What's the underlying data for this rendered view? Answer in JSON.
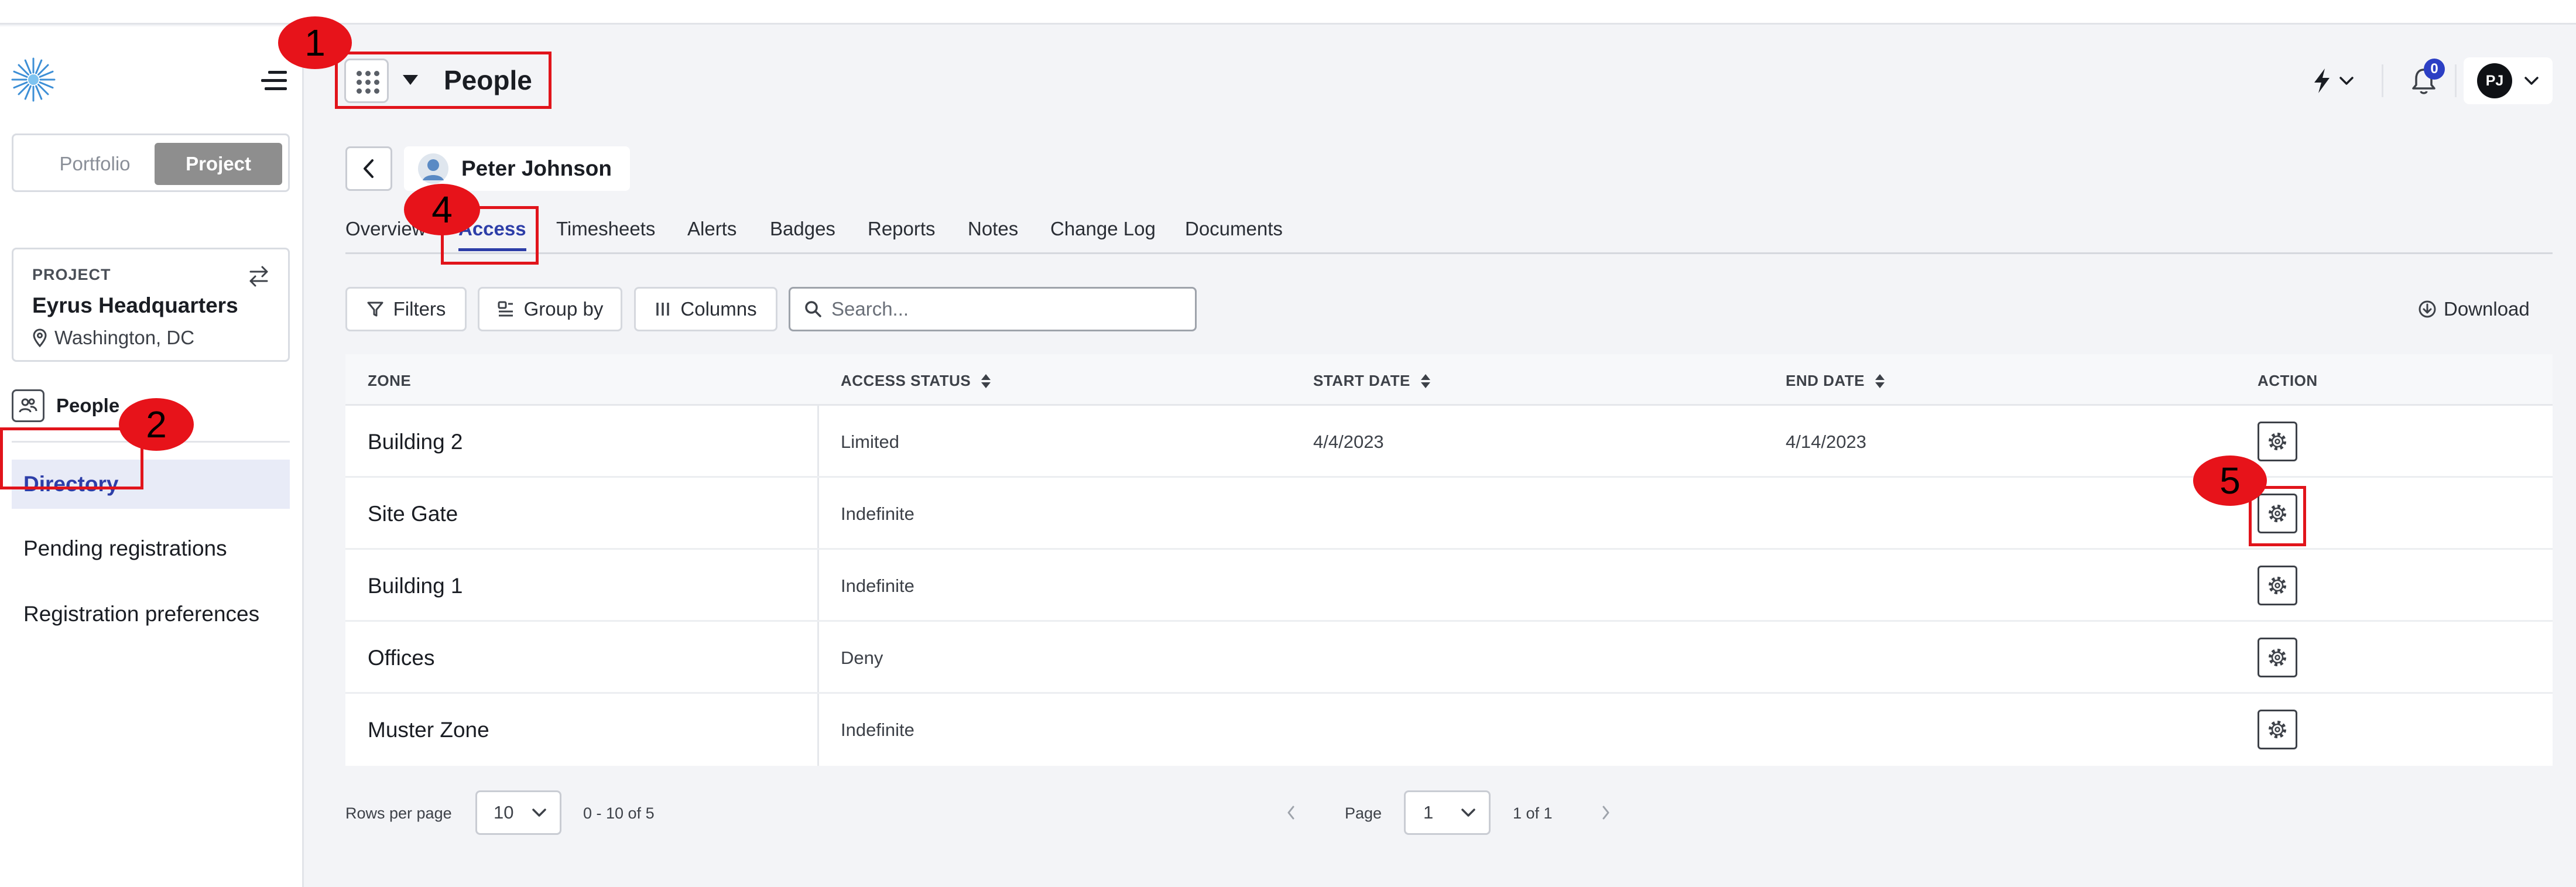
{
  "header": {
    "title": "People",
    "notification_count": "0",
    "user_initials": "PJ"
  },
  "sidebar": {
    "scope_toggle": {
      "portfolio_label": "Portfolio",
      "project_label": "Project",
      "selected": "Project"
    },
    "project_card": {
      "label": "PROJECT",
      "name": "Eyrus Headquarters",
      "location": "Washington, DC"
    },
    "section_label": "People",
    "items": [
      {
        "label": "Directory",
        "active": true
      },
      {
        "label": "Pending registrations",
        "active": false
      },
      {
        "label": "Registration preferences",
        "active": false
      }
    ]
  },
  "person": {
    "name": "Peter Johnson"
  },
  "tabs": [
    {
      "label": "Overview",
      "active": false
    },
    {
      "label": "Access",
      "active": true
    },
    {
      "label": "Timesheets",
      "active": false
    },
    {
      "label": "Alerts",
      "active": false
    },
    {
      "label": "Badges",
      "active": false
    },
    {
      "label": "Reports",
      "active": false
    },
    {
      "label": "Notes",
      "active": false
    },
    {
      "label": "Change Log",
      "active": false
    },
    {
      "label": "Documents",
      "active": false
    }
  ],
  "toolbar": {
    "filters_label": "Filters",
    "group_by_label": "Group by",
    "columns_label": "Columns",
    "search_placeholder": "Search...",
    "download_label": "Download"
  },
  "table": {
    "headers": {
      "zone": "ZONE",
      "access_status": "ACCESS STATUS",
      "start_date": "START DATE",
      "end_date": "END DATE",
      "action": "ACTION"
    },
    "rows": [
      {
        "zone": "Building 2",
        "access_status": "Limited",
        "start_date": "4/4/2023",
        "end_date": "4/14/2023"
      },
      {
        "zone": "Site Gate",
        "access_status": "Indefinite",
        "start_date": "",
        "end_date": ""
      },
      {
        "zone": "Building 1",
        "access_status": "Indefinite",
        "start_date": "",
        "end_date": ""
      },
      {
        "zone": "Offices",
        "access_status": "Deny",
        "start_date": "",
        "end_date": ""
      },
      {
        "zone": "Muster Zone",
        "access_status": "Indefinite",
        "start_date": "",
        "end_date": ""
      }
    ]
  },
  "pagination": {
    "rows_per_page_label": "Rows per page",
    "rows_per_page_value": "10",
    "range_text": "0 - 10 of 5",
    "page_label": "Page",
    "page_value": "1",
    "page_of_text": "1 of 1"
  },
  "annotations": [
    {
      "number": "1"
    },
    {
      "number": "2"
    },
    {
      "number": "4"
    },
    {
      "number": "5"
    }
  ],
  "colors": {
    "accent": "#2d3ea8",
    "annotation_red": "#e1141b",
    "project_toggle_bg": "#8e8e8e"
  }
}
